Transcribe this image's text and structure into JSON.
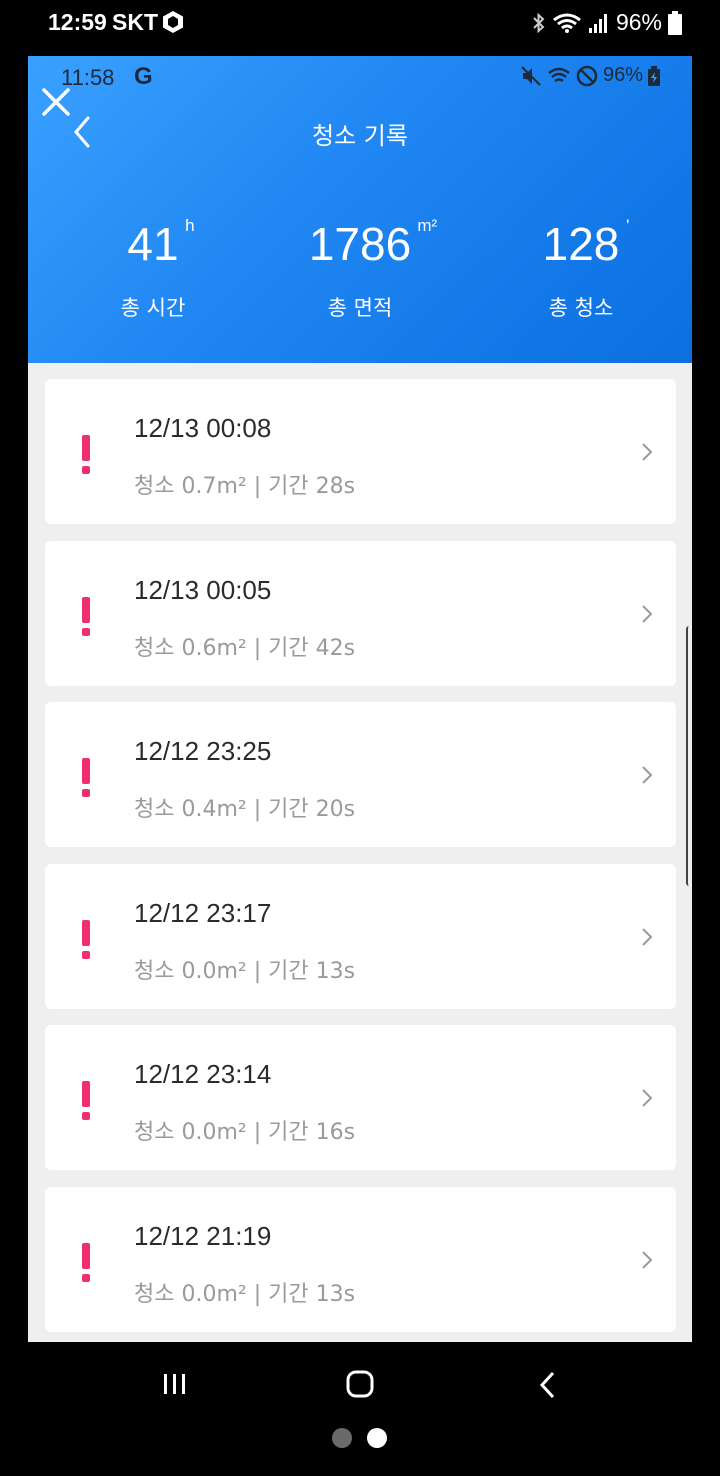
{
  "outer_status": {
    "time": "12:59",
    "carrier": "SKT",
    "battery": "96%"
  },
  "inner_status": {
    "time": "11:58",
    "network_letter": "G",
    "battery": "96%"
  },
  "header": {
    "title": "청소 기록"
  },
  "stats": [
    {
      "value": "41",
      "unit": "h",
      "label": "총 시간"
    },
    {
      "value": "1786",
      "unit": "m²",
      "label": "총 면적"
    },
    {
      "value": "128",
      "unit": "'",
      "label": "총 청소"
    }
  ],
  "records": [
    {
      "datetime": "12/13 00:08",
      "info": "청소 0.7m² | 기간 28s"
    },
    {
      "datetime": "12/13 00:05",
      "info": "청소 0.6m² | 기간 42s"
    },
    {
      "datetime": "12/12 23:25",
      "info": "청소 0.4m² | 기간 20s"
    },
    {
      "datetime": "12/12 23:17",
      "info": "청소 0.0m² | 기간 13s"
    },
    {
      "datetime": "12/12 23:14",
      "info": "청소 0.0m² | 기간 16s"
    },
    {
      "datetime": "12/12 21:19",
      "info": "청소 0.0m² | 기간 13s"
    }
  ],
  "colors": {
    "header_blue": "#1f86f2",
    "alert_pink": "#f0306e",
    "page_dot_inactive": "#6a6a6a",
    "page_dot_active": "#ffffff"
  },
  "icons": [
    "close-icon",
    "back-arrow-icon",
    "alert-icon",
    "chevron-right-icon",
    "recents-icon",
    "home-icon",
    "nav-back-icon"
  ]
}
